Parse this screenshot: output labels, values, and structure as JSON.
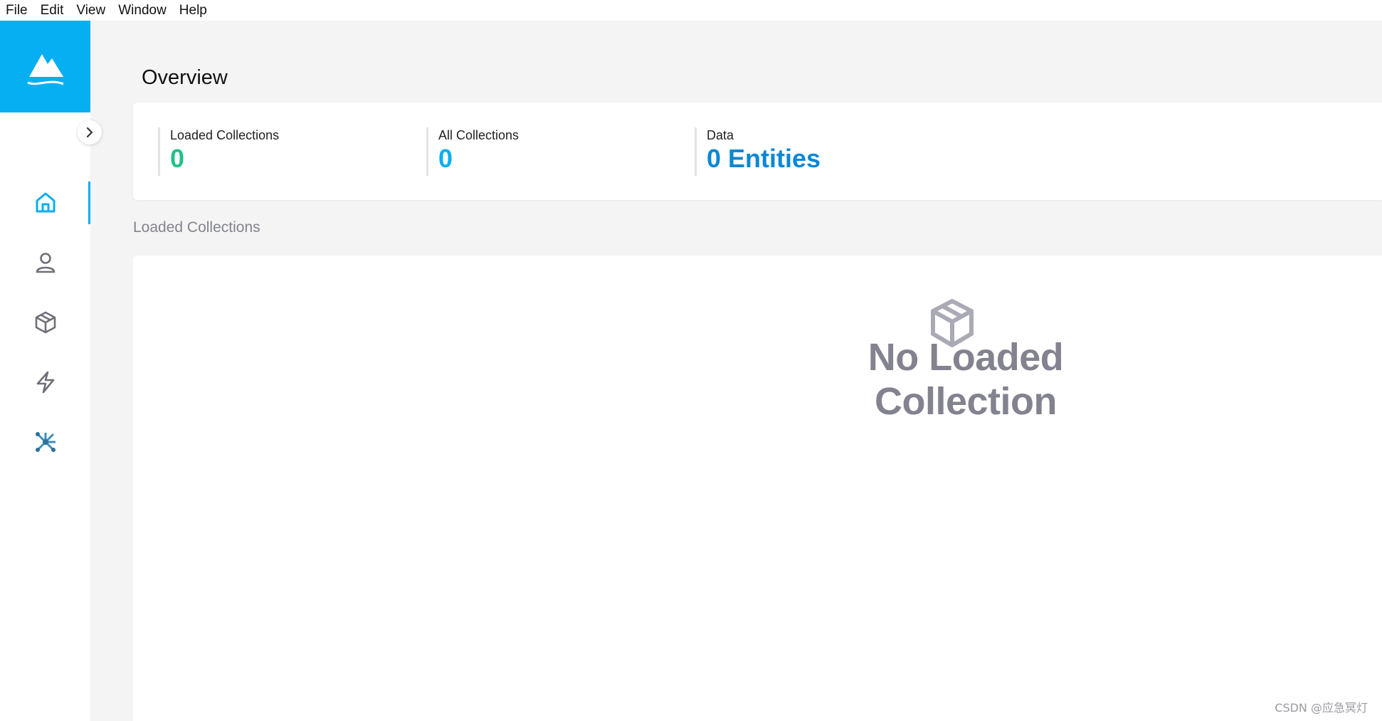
{
  "menubar": {
    "items": [
      "File",
      "Edit",
      "View",
      "Window",
      "Help"
    ]
  },
  "sidebar": {
    "logo": "milvus-logo-icon",
    "collapse_icon": "chevron-right-icon",
    "items": [
      {
        "icon": "home-icon",
        "active": true
      },
      {
        "icon": "user-icon",
        "active": false
      },
      {
        "icon": "cube-icon",
        "active": false
      },
      {
        "icon": "lightning-icon",
        "active": false
      },
      {
        "icon": "network-icon",
        "active": false
      }
    ]
  },
  "page": {
    "title": "Overview"
  },
  "stats": [
    {
      "label": "Loaded Collections",
      "value": "0",
      "color": "#1ec28b"
    },
    {
      "label": "All Collections",
      "value": "0",
      "color": "#06aff2"
    },
    {
      "label": "Data",
      "value": "0 Entities",
      "color": "#0a87d6"
    }
  ],
  "loaded_section": {
    "title": "Loaded Collections",
    "empty_icon": "cube-icon",
    "empty_text": "No Loaded Collection"
  },
  "watermark": "CSDN @应急冥灯",
  "colors": {
    "accent": "#06aff2",
    "green": "#1ec28b",
    "muted": "#82838e"
  }
}
